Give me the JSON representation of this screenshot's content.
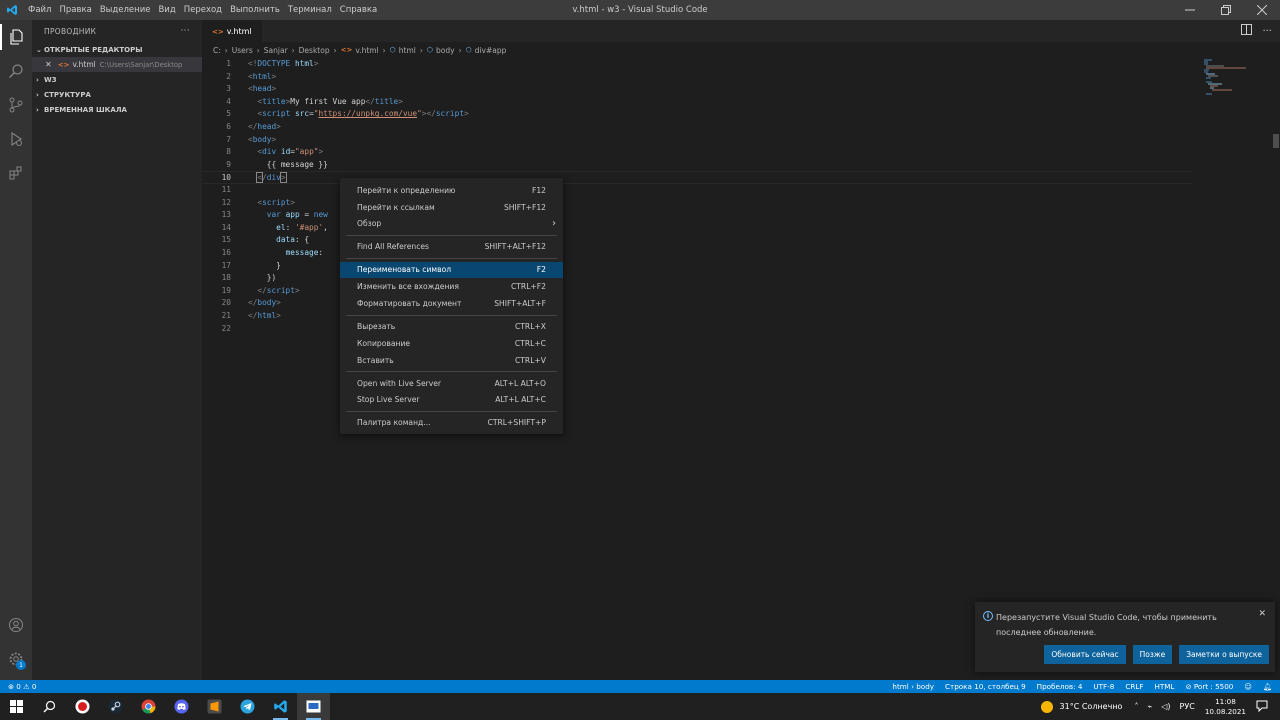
{
  "titlebar": {
    "menu": [
      "Файл",
      "Правка",
      "Выделение",
      "Вид",
      "Переход",
      "Выполнить",
      "Терминал",
      "Справка"
    ],
    "title": "v.html - w3 - Visual Studio Code"
  },
  "sidebar": {
    "title": "ПРОВОДНИК",
    "more": "···",
    "open_editors": "ОТКРЫТЫЕ РЕДАКТОРЫ",
    "open_file": {
      "name": "v.html",
      "path": "C:\\Users\\Sanjar\\Desktop"
    },
    "sections": [
      "W3",
      "СТРУКТУРА",
      "ВРЕМЕННАЯ ШКАЛА"
    ]
  },
  "tab": {
    "label": "v.html"
  },
  "breadcrumb": [
    "C:",
    "Users",
    "Sanjar",
    "Desktop",
    "v.html",
    "html",
    "body",
    "div#app"
  ],
  "editor": {
    "lines": [
      "1",
      "2",
      "3",
      "4",
      "5",
      "6",
      "7",
      "8",
      "9",
      "10",
      "11",
      "12",
      "13",
      "14",
      "15",
      "16",
      "17",
      "18",
      "19",
      "20",
      "21",
      "22"
    ],
    "current_line": 10
  },
  "context_menu": {
    "items": [
      {
        "label": "Перейти к определению",
        "shortcut": "F12"
      },
      {
        "label": "Перейти к ссылкам",
        "shortcut": "SHIFT+F12"
      },
      {
        "label": "Обзор",
        "shortcut": "›"
      },
      {
        "label": "Find All References",
        "shortcut": "SHIFT+ALT+F12"
      },
      {
        "label": "Переименовать символ",
        "shortcut": "F2"
      },
      {
        "label": "Изменить все вхождения",
        "shortcut": "CTRL+F2"
      },
      {
        "label": "Форматировать документ",
        "shortcut": "SHIFT+ALT+F"
      },
      {
        "label": "Вырезать",
        "shortcut": "CTRL+X"
      },
      {
        "label": "Копирование",
        "shortcut": "CTRL+C"
      },
      {
        "label": "Вставить",
        "shortcut": "CTRL+V"
      },
      {
        "label": "Open with Live Server",
        "shortcut": "ALT+L ALT+O"
      },
      {
        "label": "Stop Live Server",
        "shortcut": "ALT+L ALT+C"
      },
      {
        "label": "Палитра команд...",
        "shortcut": "CTRL+SHIFT+P"
      }
    ]
  },
  "notification": {
    "message": "Перезапустите Visual Studio Code, чтобы применить последнее обновление.",
    "buttons": [
      "Обновить сейчас",
      "Позже",
      "Заметки о выпуске"
    ]
  },
  "statusbar": {
    "problems": "⊗ 0 ⚠ 0",
    "breadcrumb": "html › body",
    "position": "Строка 10, столбец 9",
    "spaces": "Пробелов: 4",
    "encoding": "UTF-8",
    "eol": "CRLF",
    "language": "HTML",
    "port": "⊘ Port : 5500"
  },
  "taskbar": {
    "weather": "31°C Солнечно",
    "lang": "РУС",
    "time": "11:08",
    "date": "10.08.2021"
  },
  "colors": {
    "accent": "#007acc",
    "selection": "#094771",
    "button": "#0e639c"
  }
}
